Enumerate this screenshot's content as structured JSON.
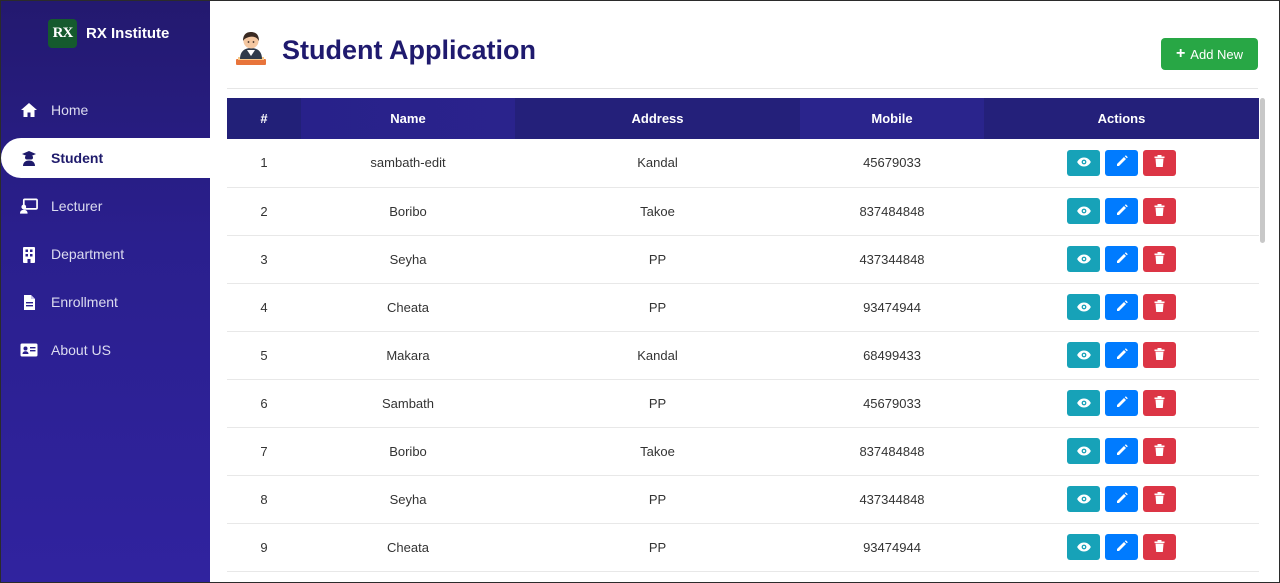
{
  "brand": {
    "logo": "RX",
    "name": "RX Institute"
  },
  "sidebar": {
    "items": [
      {
        "label": "Home",
        "icon": "home-icon",
        "active": false
      },
      {
        "label": "Student",
        "icon": "student-icon",
        "active": true
      },
      {
        "label": "Lecturer",
        "icon": "lecturer-icon",
        "active": false
      },
      {
        "label": "Department",
        "icon": "building-icon",
        "active": false
      },
      {
        "label": "Enrollment",
        "icon": "document-icon",
        "active": false
      },
      {
        "label": "About US",
        "icon": "id-card-icon",
        "active": false
      }
    ]
  },
  "header": {
    "title": "Student Application",
    "add_label": "Add New"
  },
  "table": {
    "columns": [
      "#",
      "Name",
      "Address",
      "Mobile",
      "Actions"
    ],
    "rows": [
      [
        "1",
        "sambath-edit",
        "Kandal",
        "45679033"
      ],
      [
        "2",
        "Boribo",
        "Takoe",
        "837484848"
      ],
      [
        "3",
        "Seyha",
        "PP",
        "437344848"
      ],
      [
        "4",
        "Cheata",
        "PP",
        "93474944"
      ],
      [
        "5",
        "Makara",
        "Kandal",
        "68499433"
      ],
      [
        "6",
        "Sambath",
        "PP",
        "45679033"
      ],
      [
        "7",
        "Boribo",
        "Takoe",
        "837484848"
      ],
      [
        "8",
        "Seyha",
        "PP",
        "437344848"
      ],
      [
        "9",
        "Cheata",
        "PP",
        "93474944"
      ]
    ]
  },
  "colors": {
    "sidebar_top": "#23196f",
    "sidebar_bottom": "#30239f",
    "accent": "#1f1a6e",
    "add_button": "#28a745",
    "view_button": "#17a2b8",
    "edit_button": "#007bff",
    "delete_button": "#dc3545"
  }
}
